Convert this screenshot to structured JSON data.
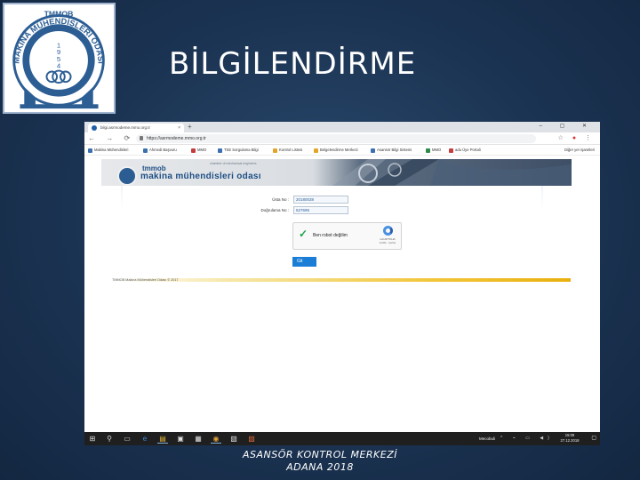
{
  "logo": {
    "top_text": "TMMOB",
    "ring_text": "MAKİNA MÜHENDİSLERİ ODASI",
    "year": [
      "1",
      "9",
      "5",
      "4"
    ]
  },
  "slide": {
    "title": "BİLGİLENDİRME",
    "caption_line1": "ASANSÖR KONTROL MERKEZİ",
    "caption_line2": "ADANA 2018"
  },
  "browser": {
    "tab_title": "bilgi.asrmodeme.mmo.org.tr",
    "tab_close": "×",
    "new_tab": "+",
    "window_controls": "–  ▢  ✕",
    "nav_buttons": "← → ⟳ ⌂",
    "url": "https://asrmodeme.mmo.org.tr",
    "extensions": [
      "☆",
      "●",
      "⋮"
    ],
    "bookmarks": [
      {
        "label": "Makina Mühendisleri",
        "tone": "b"
      },
      {
        "label": "Ahmedi Başvuru",
        "tone": "b"
      },
      {
        "label": "MMO",
        "tone": "r"
      },
      {
        "label": "TSE Sorgulama Bilgi",
        "tone": "b"
      },
      {
        "label": "Kontrol Listesi",
        "tone": "y"
      },
      {
        "label": "Belgelendirme Merkezi",
        "tone": "y"
      },
      {
        "label": "Asansör Bilgi Sistemi",
        "tone": "b"
      },
      {
        "label": "MMO",
        "tone": "g"
      },
      {
        "label": "adu Üye Portali",
        "tone": "r"
      }
    ],
    "bookmarks_other": "Diğer yer işaretleri"
  },
  "page": {
    "banner_org_line1": "tmmob",
    "banner_org_line2": "makina mühendisleri odası",
    "banner_slogan": "chamber of mechanical engineers",
    "fields": [
      {
        "label": "Üsta No :",
        "value": "20180038"
      },
      {
        "label": "Doğrulama No :",
        "value": "527695"
      }
    ],
    "recaptcha": {
      "label": "Ben robot değilim",
      "brand": "reCAPTCHA",
      "terms": "Gizlilik - Şartlar"
    },
    "submit_label": "Git",
    "footer": "TMMOB Makina Mühendisleri Odası © 2017"
  },
  "taskbar": {
    "icons": [
      "⊞",
      "⚲",
      "▭",
      "e",
      "▤",
      "▣",
      "▦",
      "◉",
      "▧",
      "▨"
    ],
    "user": "Mecobuli",
    "tray": "^ ⌁ ▭ ◀)",
    "time": "15:09",
    "date": "27.12.2018",
    "notification": "▢"
  }
}
